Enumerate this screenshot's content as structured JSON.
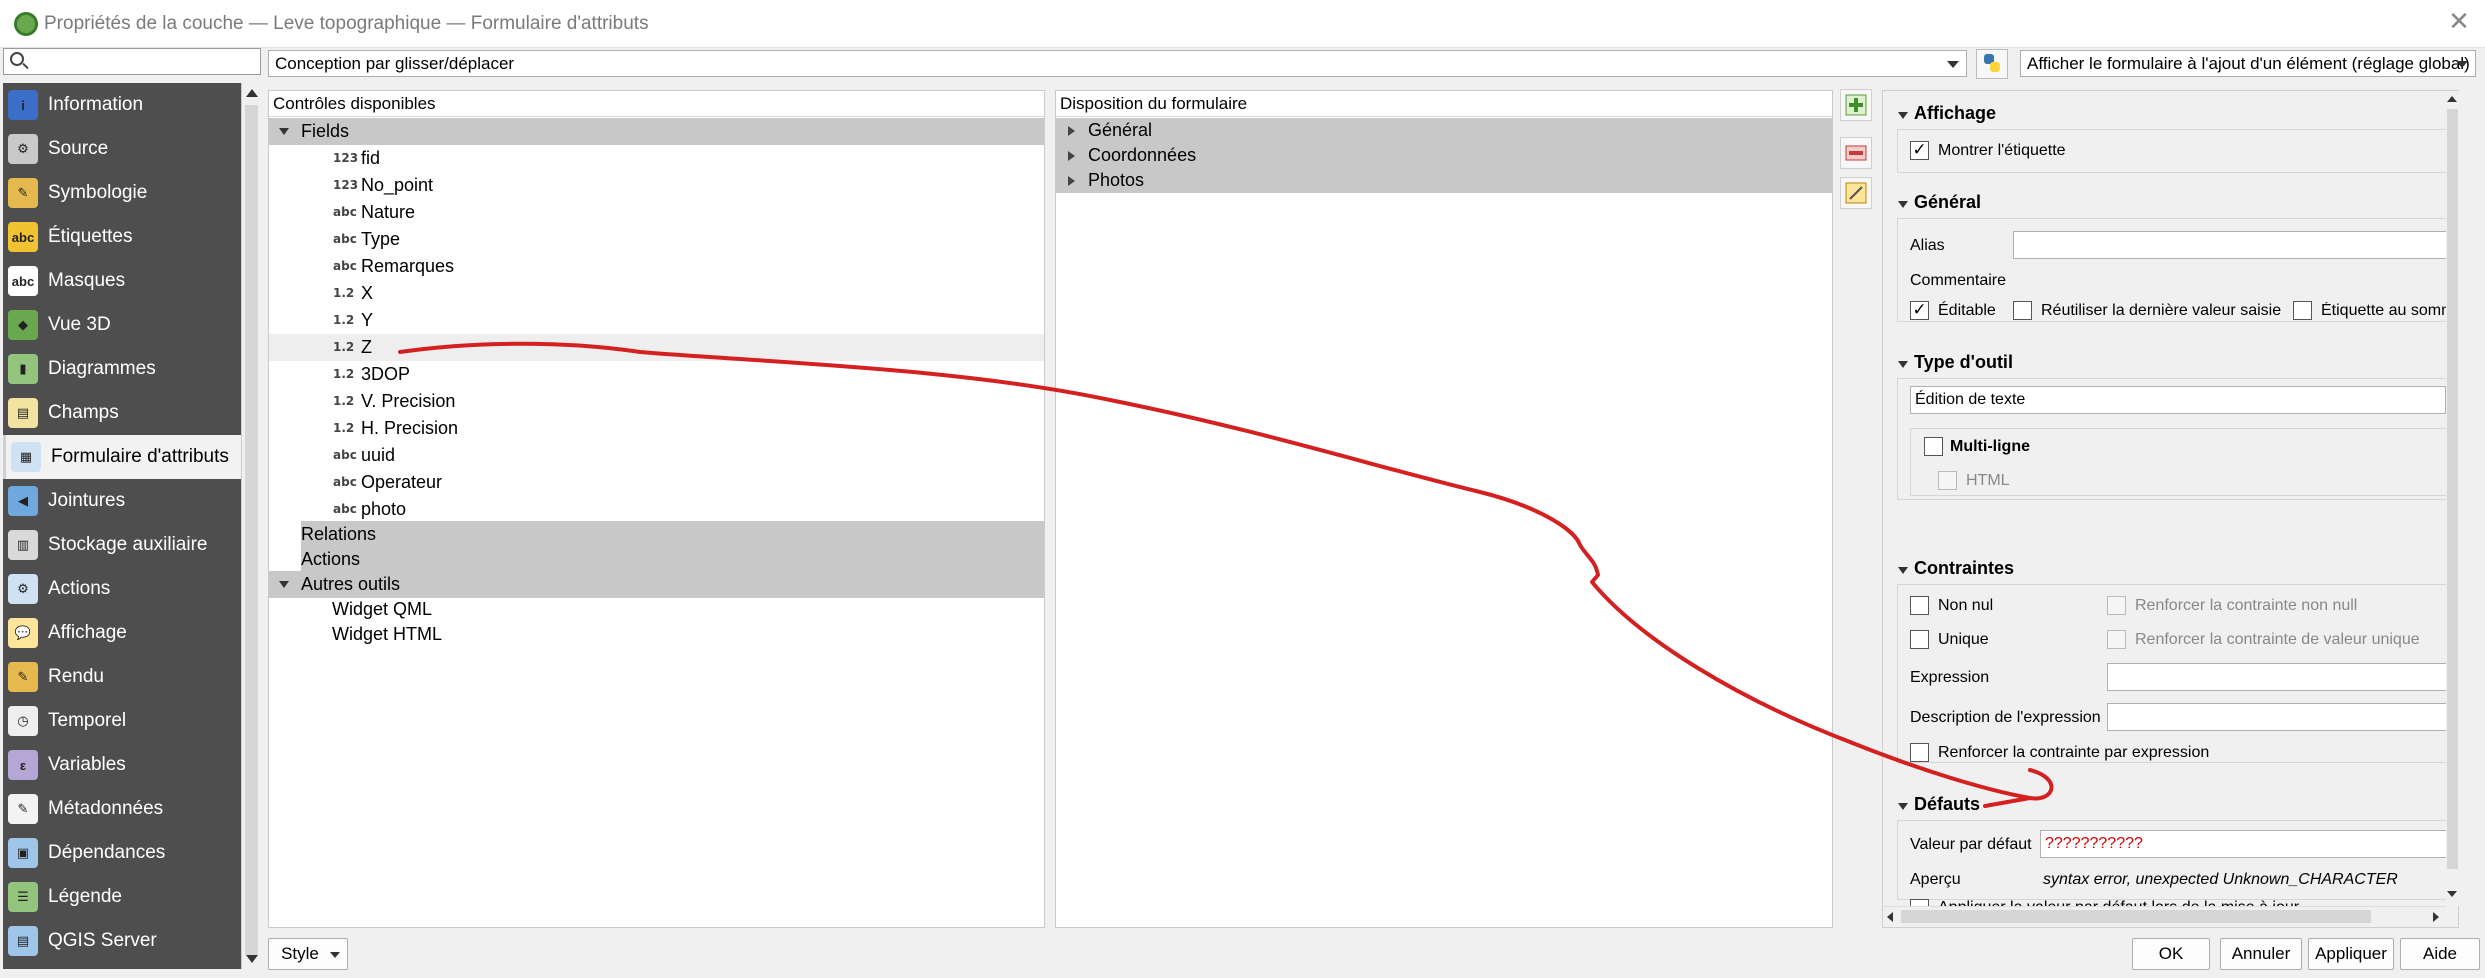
{
  "window": {
    "title": "Propriétés de la couche — Leve topographique — Formulaire d'attributs",
    "close_glyph": "✕"
  },
  "search": {
    "placeholder": "",
    "value": ""
  },
  "sidebar": {
    "items": [
      {
        "label": "Information",
        "icon": "information-icon",
        "color": "#3b6ec9",
        "glyph": "i"
      },
      {
        "label": "Source",
        "icon": "source-icon",
        "color": "#c9c9c9",
        "glyph": "⚙"
      },
      {
        "label": "Symbologie",
        "icon": "symbology-icon",
        "color": "#e6b94f",
        "glyph": "✎"
      },
      {
        "label": "Étiquettes",
        "icon": "labels-icon",
        "color": "#f1c232",
        "glyph": "abc"
      },
      {
        "label": "Masques",
        "icon": "masks-icon",
        "color": "#ffffff",
        "glyph": "abc"
      },
      {
        "label": "Vue 3D",
        "icon": "3d-view-icon",
        "color": "#6aa84f",
        "glyph": "◆"
      },
      {
        "label": "Diagrammes",
        "icon": "diagrams-icon",
        "color": "#93c47d",
        "glyph": "▮"
      },
      {
        "label": "Champs",
        "icon": "fields-icon",
        "color": "#f3e3a0",
        "glyph": "▤"
      },
      {
        "label": "Formulaire d'attributs",
        "icon": "attribute-form-icon",
        "color": "#cfe2f3",
        "glyph": "▦"
      },
      {
        "label": "Jointures",
        "icon": "joins-icon",
        "color": "#6fa8dc",
        "glyph": "◀"
      },
      {
        "label": "Stockage auxiliaire",
        "icon": "auxiliary-storage-icon",
        "color": "#d9d9d9",
        "glyph": "▥"
      },
      {
        "label": "Actions",
        "icon": "actions-icon",
        "color": "#cfe2f3",
        "glyph": "⚙"
      },
      {
        "label": "Affichage",
        "icon": "display-icon",
        "color": "#ffe599",
        "glyph": "💬"
      },
      {
        "label": "Rendu",
        "icon": "rendering-icon",
        "color": "#e6b94f",
        "glyph": "✎"
      },
      {
        "label": "Temporel",
        "icon": "temporal-icon",
        "color": "#eeeeee",
        "glyph": "◷"
      },
      {
        "label": "Variables",
        "icon": "variables-icon",
        "color": "#b4a7d6",
        "glyph": "ε"
      },
      {
        "label": "Métadonnées",
        "icon": "metadata-icon",
        "color": "#f3f3f3",
        "glyph": "✎"
      },
      {
        "label": "Dépendances",
        "icon": "dependencies-icon",
        "color": "#9fc5e8",
        "glyph": "▣"
      },
      {
        "label": "Légende",
        "icon": "legend-icon",
        "color": "#93c47d",
        "glyph": "☰"
      },
      {
        "label": "QGIS Server",
        "icon": "qgis-server-icon",
        "color": "#9fc5e8",
        "glyph": "▤"
      }
    ],
    "active_index": 8
  },
  "style_button": {
    "label": "Style"
  },
  "editor_combo": {
    "value": "Conception par glisser/déplacer"
  },
  "python_button": {
    "icon": "python-icon"
  },
  "suppress_combo": {
    "value": "Afficher le formulaire à l'ajout d'un élément (réglage global)"
  },
  "available": {
    "header": "Contrôles disponibles",
    "fields_group": "Fields",
    "fields": [
      {
        "type": "123",
        "name": "fid"
      },
      {
        "type": "123",
        "name": "No_point"
      },
      {
        "type": "abc",
        "name": "Nature"
      },
      {
        "type": "abc",
        "name": "Type"
      },
      {
        "type": "abc",
        "name": "Remarques"
      },
      {
        "type": "1.2",
        "name": "X"
      },
      {
        "type": "1.2",
        "name": "Y"
      },
      {
        "type": "1.2",
        "name": "Z"
      },
      {
        "type": "1.2",
        "name": "3DOP"
      },
      {
        "type": "1.2",
        "name": "V. Precision"
      },
      {
        "type": "1.2",
        "name": "H. Precision"
      },
      {
        "type": "abc",
        "name": "uuid"
      },
      {
        "type": "abc",
        "name": "Operateur"
      },
      {
        "type": "abc",
        "name": "photo"
      }
    ],
    "selected_field": "Z",
    "relations": "Relations",
    "actions": "Actions",
    "other_tools": "Autres outils",
    "widgets": [
      "Widget QML",
      "Widget HTML"
    ]
  },
  "layout": {
    "header": "Disposition du formulaire",
    "tabs": [
      "Général",
      "Coordonnées",
      "Photos"
    ]
  },
  "widget_config": {
    "display": {
      "title": "Affichage",
      "show_label": "Montrer l'étiquette",
      "show_label_checked": true
    },
    "general": {
      "title": "Général",
      "alias_label": "Alias",
      "alias_value": "",
      "comment_label": "Commentaire",
      "editable": "Éditable",
      "editable_checked": true,
      "reuse_last": "Réutiliser la dernière valeur saisie",
      "label_on_top": "Étiquette au sommet"
    },
    "widget_type": {
      "title": "Type d'outil",
      "value": "Édition de texte",
      "multiline": "Multi-ligne",
      "html": "HTML"
    },
    "constraints": {
      "title": "Contraintes",
      "not_null": "Non nul",
      "enforce_not_null": "Renforcer la contrainte non null",
      "unique": "Unique",
      "enforce_unique": "Renforcer la contrainte de valeur unique",
      "expression_label": "Expression",
      "expression_desc_label": "Description de l'expression",
      "enforce_expression": "Renforcer la contrainte par expression"
    },
    "defaults": {
      "title": "Défauts",
      "default_label": "Valeur par défaut",
      "default_value": "???????????",
      "preview_label": "Aperçu",
      "preview_value": "syntax error, unexpected Unknown_CHARACTER",
      "apply_on_update": "Appliquer la valeur par défaut lors de la mise à jour"
    }
  },
  "buttons": {
    "ok": "OK",
    "cancel": "Annuler",
    "apply": "Appliquer",
    "help": "Aide"
  },
  "colors": {
    "error_text": "#d40000",
    "annotation": "#d42020",
    "sidebar_bg": "#4e4e4e",
    "group_bg": "#c8c8c8"
  }
}
